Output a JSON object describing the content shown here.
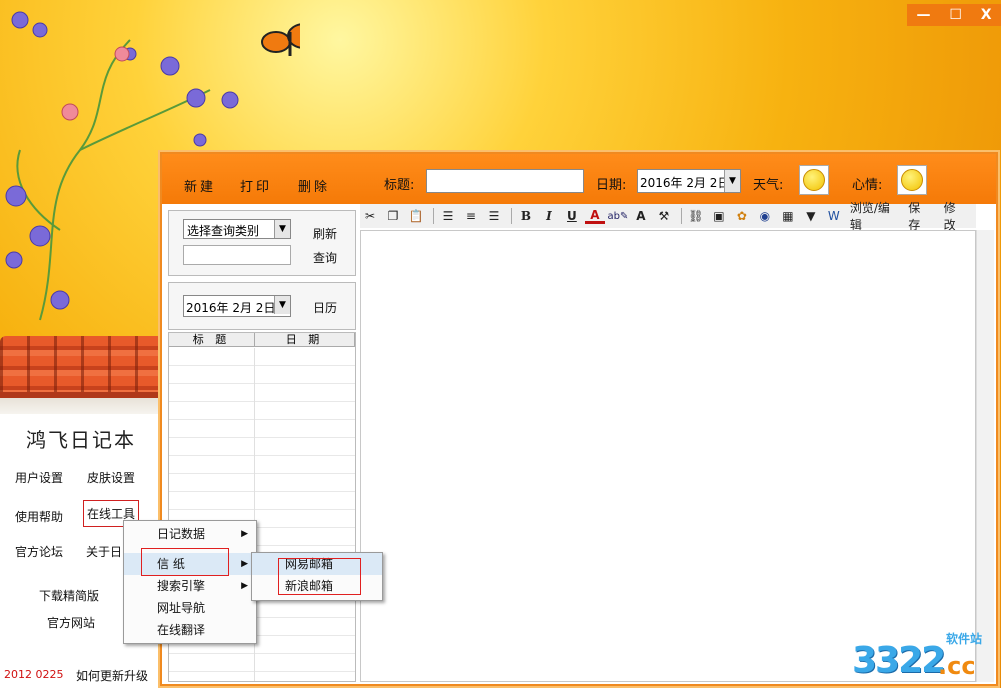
{
  "window_controls": {
    "minimize": "—",
    "maximize": "☐",
    "close": "X"
  },
  "left_panel": {
    "app_title": "鸿飞日记本",
    "user_settings": "用户设置",
    "skin_settings": "皮肤设置",
    "help": "使用帮助",
    "online_tools": "在线工具",
    "forum": "官方论坛",
    "about": "关于日",
    "download_lite": "下载精简版",
    "official_site": "官方网站",
    "version": "2012 0225",
    "upgrade": "如何更新升级"
  },
  "toolbar": {
    "new": "新建",
    "print": "打印",
    "delete": "删除",
    "title_label": "标题:",
    "title_value": "",
    "date_label": "日期:",
    "date_value": "2016年 2月 2日",
    "weather_label": "天气:",
    "weather_icon": "sun-icon",
    "mood_label": "心情:",
    "mood_icon": "smiley-icon"
  },
  "query_panel": {
    "category_select": "选择查询类别",
    "refresh": "刷新",
    "query": "查询",
    "date_value": "2016年 2月 2日",
    "calendar": "日历"
  },
  "diary_list": {
    "columns": [
      "标 题",
      "日 期"
    ]
  },
  "editor_toolbar": {
    "bold": "B",
    "italic": "I",
    "underline": "U",
    "font_color": "A",
    "font_size": "A",
    "browse_edit": "浏览/编辑",
    "save": "保 存",
    "modify": "修 改"
  },
  "context_menu": {
    "items": [
      "日记数据",
      "信 纸",
      "搜索引擎",
      "网址导航",
      "在线翻译"
    ],
    "highlighted": "信 纸"
  },
  "submenu": {
    "items": [
      "网易邮箱",
      "新浪邮箱"
    ],
    "highlighted": "网易邮箱"
  },
  "watermark": {
    "digits": "3322",
    "suffix": ".cc",
    "site": "软件站"
  },
  "colors": {
    "accent": "#f57a08",
    "highlight_box": "#e02020",
    "version_text": "#d01010"
  }
}
